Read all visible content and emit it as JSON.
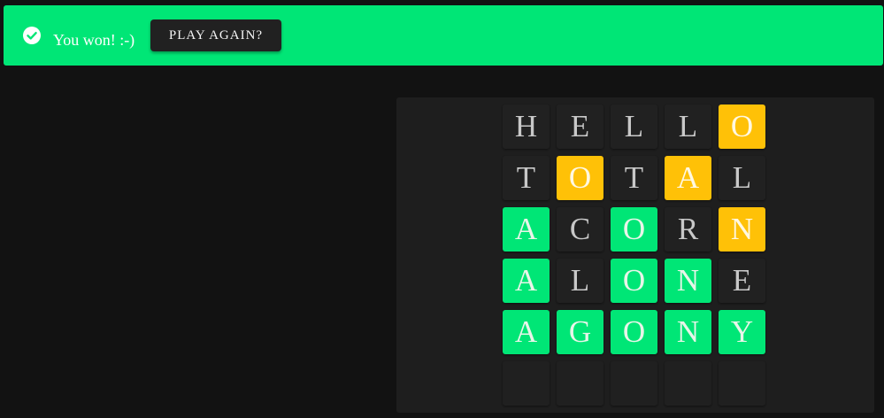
{
  "banner": {
    "message": "You won! :-)",
    "play_again_label": "PLAY AGAIN?",
    "color": "#00e676"
  },
  "colors": {
    "correct": "#00e676",
    "present": "#ffc107",
    "absent": "#212121",
    "background": "#121212"
  },
  "board": {
    "rows": [
      [
        {
          "letter": "H",
          "state": "absent"
        },
        {
          "letter": "E",
          "state": "absent"
        },
        {
          "letter": "L",
          "state": "absent"
        },
        {
          "letter": "L",
          "state": "absent"
        },
        {
          "letter": "O",
          "state": "present"
        }
      ],
      [
        {
          "letter": "T",
          "state": "absent"
        },
        {
          "letter": "O",
          "state": "present"
        },
        {
          "letter": "T",
          "state": "absent"
        },
        {
          "letter": "A",
          "state": "present"
        },
        {
          "letter": "L",
          "state": "absent"
        }
      ],
      [
        {
          "letter": "A",
          "state": "correct"
        },
        {
          "letter": "C",
          "state": "absent"
        },
        {
          "letter": "O",
          "state": "correct"
        },
        {
          "letter": "R",
          "state": "absent"
        },
        {
          "letter": "N",
          "state": "present"
        }
      ],
      [
        {
          "letter": "A",
          "state": "correct"
        },
        {
          "letter": "L",
          "state": "absent"
        },
        {
          "letter": "O",
          "state": "correct"
        },
        {
          "letter": "N",
          "state": "correct"
        },
        {
          "letter": "E",
          "state": "absent"
        }
      ],
      [
        {
          "letter": "A",
          "state": "correct"
        },
        {
          "letter": "G",
          "state": "correct"
        },
        {
          "letter": "O",
          "state": "correct"
        },
        {
          "letter": "N",
          "state": "correct"
        },
        {
          "letter": "Y",
          "state": "correct"
        }
      ],
      [
        {
          "letter": "",
          "state": "empty"
        },
        {
          "letter": "",
          "state": "empty"
        },
        {
          "letter": "",
          "state": "empty"
        },
        {
          "letter": "",
          "state": "empty"
        },
        {
          "letter": "",
          "state": "empty"
        }
      ]
    ]
  }
}
